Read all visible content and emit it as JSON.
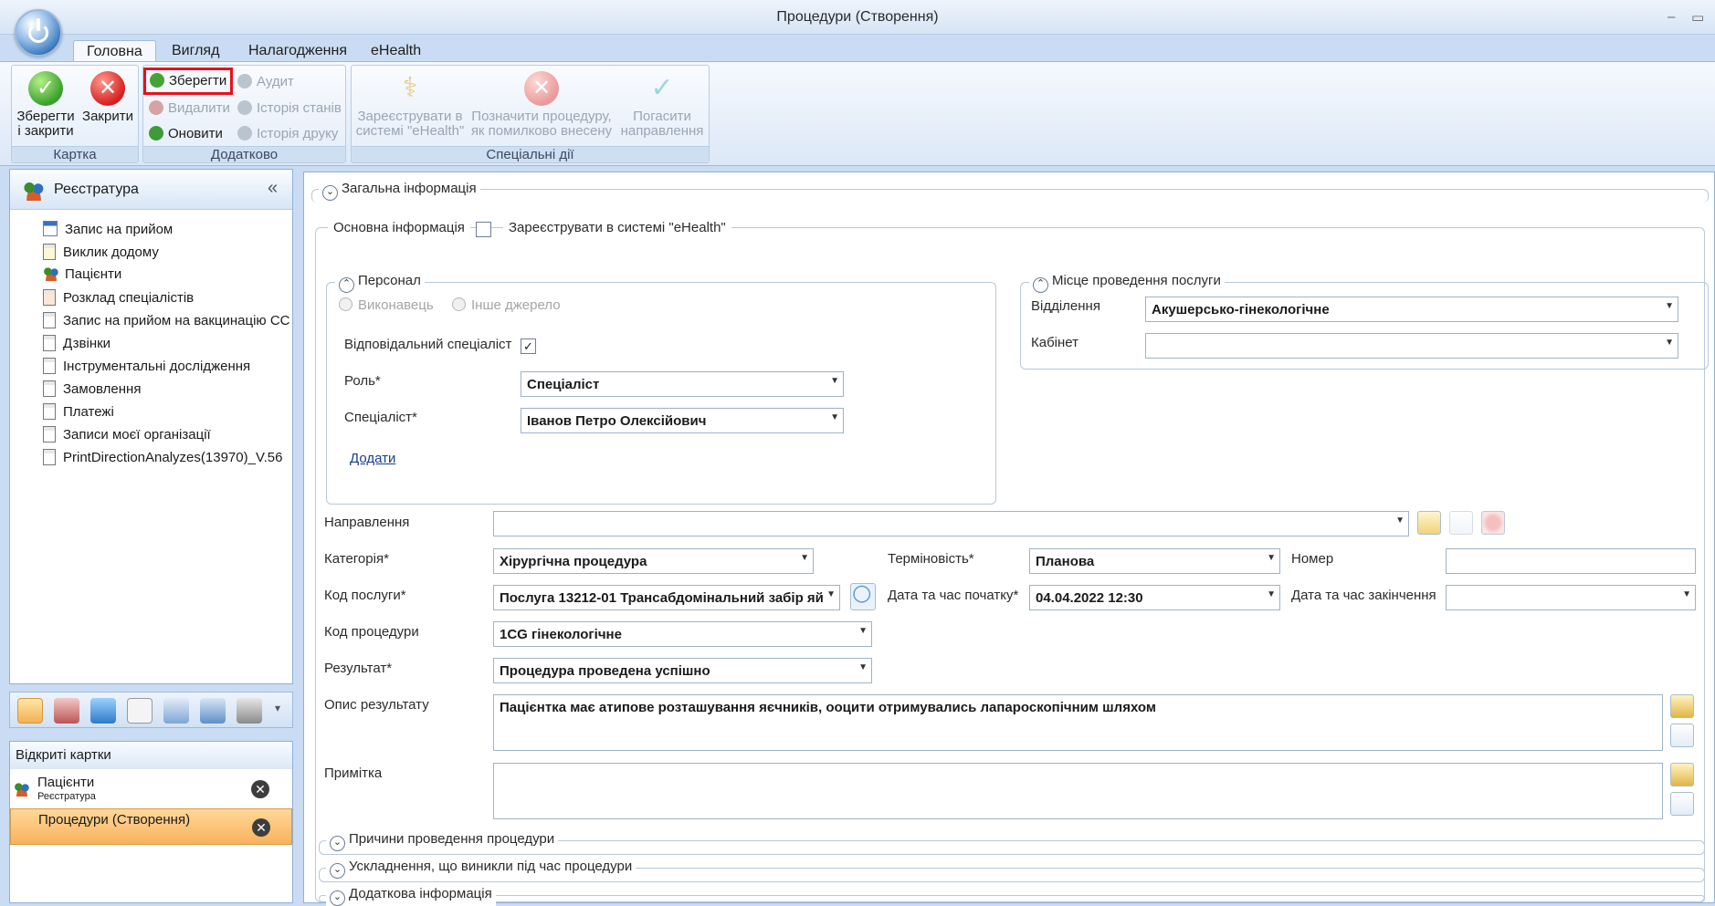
{
  "window": {
    "title": "Процедури (Створення)",
    "minimize": "–",
    "restore": "▭"
  },
  "ribbon": {
    "tabs": [
      "Головна",
      "Вигляд",
      "Налагодження",
      "eHealth"
    ],
    "groups": {
      "card": {
        "label": "Картка",
        "save_close": [
          "Зберегти",
          "і закрити"
        ],
        "close": "Закрити"
      },
      "extra": {
        "label": "Додатково",
        "save": "Зберегти",
        "delete": "Видалити",
        "refresh": "Оновити",
        "audit": "Аудит",
        "state_history": "Історія станів",
        "print_history": "Історія друку"
      },
      "special": {
        "label": "Спеціальні дії",
        "register": [
          "Зареєструвати в",
          "системі \"eHealth\""
        ],
        "mark_error": [
          "Позначити процедуру,",
          "як помилково внесену"
        ],
        "cancel_direction": [
          "Погасити",
          "направлення"
        ]
      }
    }
  },
  "nav": {
    "title": "Реєстратура",
    "collapse": "«",
    "items": [
      {
        "label": "Запис на прийом",
        "icon": "calendar-icon"
      },
      {
        "label": "Виклик додому",
        "icon": "house-call-icon"
      },
      {
        "label": "Пацієнти",
        "icon": "patients-icon"
      },
      {
        "label": "Розклад спеціалістів",
        "icon": "schedule-icon"
      },
      {
        "label": "Запис на прийом на вакцинацію СС",
        "icon": "document-icon"
      },
      {
        "label": "Дзвінки",
        "icon": "document-icon"
      },
      {
        "label": "Інструментальні дослідження",
        "icon": "document-icon"
      },
      {
        "label": "Замовлення",
        "icon": "document-icon"
      },
      {
        "label": "Платежі",
        "icon": "document-icon"
      },
      {
        "label": "Записи моєї організації",
        "icon": "document-icon"
      },
      {
        "label": "PrintDirectionAnalyzes(13970)_V.56",
        "icon": "document-icon"
      }
    ],
    "more": "▾"
  },
  "open_cards": {
    "title": "Відкриті картки",
    "items": [
      {
        "title": "Пацієнти",
        "subtitle": "Реєстратура",
        "close": "✕"
      },
      {
        "title": "Процедури (Створення)",
        "subtitle": "",
        "close": "✕"
      }
    ]
  },
  "form": {
    "general": {
      "title": "Загальна інформація",
      "toggle": "⌄"
    },
    "basic": {
      "title": "Основна інформація",
      "ehealth_register_label": "Зареєструвати в системі \"eHealth\""
    },
    "personnel": {
      "title": "Персонал",
      "toggle": "⌃",
      "radio_performer": "Виконавець",
      "radio_other": "Інше джерело",
      "responsible_label": "Відповідальний спеціаліст",
      "responsible_mark": "✓",
      "role_label": "Роль*",
      "role_value": "Спеціаліст",
      "specialist_label": "Спеціаліст*",
      "specialist_value": "Іванов Петро Олексійович",
      "add_link": "Додати"
    },
    "place": {
      "title": "Місце проведення послуги",
      "toggle": "⌃",
      "department_label": "Відділення",
      "department_value": "Акушерсько-гінекологічне",
      "cabinet_label": "Кабінет",
      "cabinet_value": ""
    },
    "direction_label": "Направлення",
    "direction_value": "",
    "category_label": "Категорія*",
    "category_value": "Хірургічна процедура",
    "urgency_label": "Терміновість*",
    "urgency_value": "Планова",
    "number_label": "Номер",
    "number_value": "",
    "service_code_label": "Код послуги*",
    "service_code_value": "Послуга 13212-01 Трансабдомінальний забір яй",
    "start_label": "Дата та час початку*",
    "start_value": "04.04.2022 12:30",
    "end_label": "Дата та час закінчення",
    "end_value": "",
    "procedure_code_label": "Код процедури",
    "procedure_code_value": "1CG гінекологічне",
    "result_label": "Результат*",
    "result_value": "Процедура проведена успішно",
    "result_desc_label": "Опис результату",
    "result_desc_value": "Пацієнтка має атипове розташування яєчників, ооцити отримувались лапароскопічним шляхом",
    "note_label": "Примітка",
    "note_value": "",
    "reasons_title": "Причини проведення процедури",
    "complications_title": "Ускладнення, що виникли під час процедури",
    "additional_title": "Додаткова інформація",
    "expand_toggle": "⌄"
  },
  "colors": {
    "accent": "#2f6eb4",
    "highlight": "#e8101b",
    "active_card": "#f8b25b"
  }
}
